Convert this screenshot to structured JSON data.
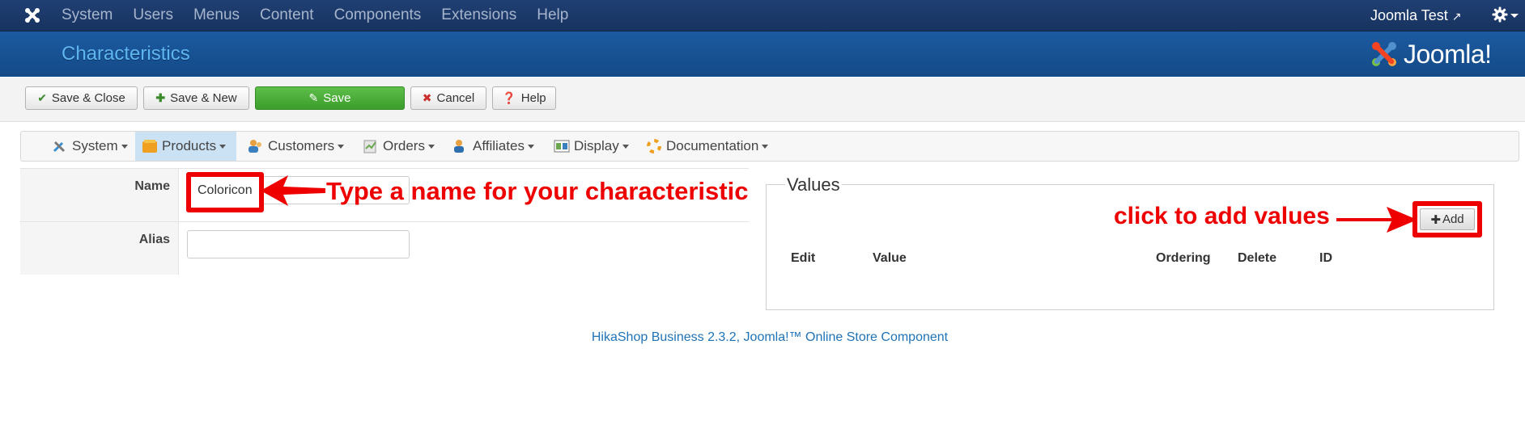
{
  "topbar": {
    "menu": [
      "System",
      "Users",
      "Menus",
      "Content",
      "Components",
      "Extensions",
      "Help"
    ],
    "site_name": "Joomla Test",
    "icons": [
      "joomla-icon",
      "external-link-icon",
      "gear-icon"
    ]
  },
  "title_bar": {
    "title": "Characteristics",
    "brand": "Joomla!"
  },
  "toolbar": {
    "save_close": "Save & Close",
    "save_new": "Save & New",
    "save": "Save",
    "cancel": "Cancel",
    "help": "Help"
  },
  "submenu": {
    "items": [
      "System",
      "Products",
      "Customers",
      "Orders",
      "Affiliates",
      "Display",
      "Documentation"
    ],
    "active": "Products"
  },
  "form": {
    "name_label": "Name",
    "name_value": "Coloricon",
    "alias_label": "Alias",
    "alias_value": ""
  },
  "values": {
    "legend": "Values",
    "add_label": "Add",
    "columns": [
      "Edit",
      "Value",
      "Ordering",
      "Delete",
      "ID"
    ]
  },
  "annotations": {
    "name_hint": "Type a name for your characteristic",
    "add_hint": "click to add values"
  },
  "footer": {
    "text": "HikaShop Business 2.3.2, Joomla!™ Online Store Component"
  },
  "colors": {
    "topbar": "#1a3867",
    "titlebar": "#1b5aa0",
    "title_text": "#5fb6f0",
    "save_green": "#4cae3a",
    "annotation_red": "#ee0000",
    "link_blue": "#1f73b7"
  }
}
